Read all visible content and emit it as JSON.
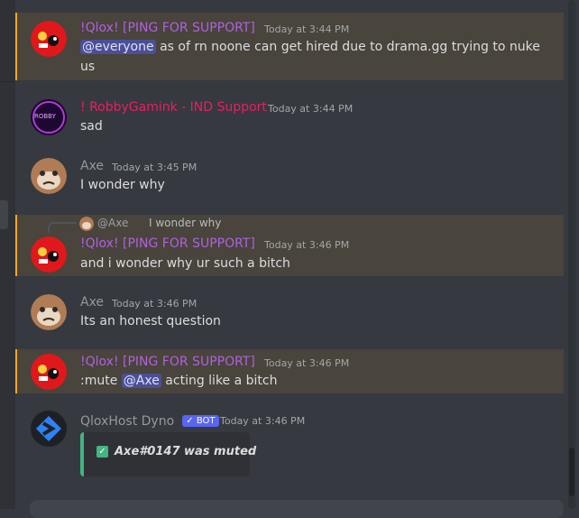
{
  "messages": [
    {
      "author": "!Qlox! [PING FOR SUPPORT]",
      "author_color": "#b061e0",
      "timestamp": "Today at 3:44 PM",
      "mention_everyone": "@everyone",
      "text_line1": "as of rn noone can get hired due to drama.gg trying to nuke",
      "text_line2": "us",
      "highlighted": true
    },
    {
      "author": "! RobbyGamink - IND Support",
      "author_color": "#e91e63",
      "timestamp": "Today at 3:44 PM",
      "text": "sad",
      "avatar_text": "ROBBY"
    },
    {
      "author": "Axe",
      "author_color": "#96989d",
      "timestamp": "Today at 3:45 PM",
      "text": "I wonder why"
    },
    {
      "reply_to_mention": "@Axe",
      "reply_to_text": "I wonder why",
      "author": "!Qlox! [PING FOR SUPPORT]",
      "timestamp": "Today at 3:46 PM",
      "text": "and i wonder why ur such a bitch",
      "highlighted": true
    },
    {
      "author": "Axe",
      "timestamp": "Today at 3:46 PM",
      "text": "Its an honest question"
    },
    {
      "author": "!Qlox! [PING FOR SUPPORT]",
      "timestamp": "Today at 3:46 PM",
      "text_prefix": ":mute",
      "mention": "@Axe",
      "text_suffix": "acting like a bitch",
      "highlighted": true
    },
    {
      "author": "QloxHost Dyno",
      "bot_tag": "BOT",
      "timestamp": "Today at 3:46 PM",
      "embed_text": "Axe#0147 was muted"
    }
  ],
  "colors": {
    "background": "#36393f",
    "mention_highlight": "#49443c",
    "mention_bar": "#faa81a",
    "embed_bar": "#43b581",
    "bot_badge": "#5865f2"
  }
}
